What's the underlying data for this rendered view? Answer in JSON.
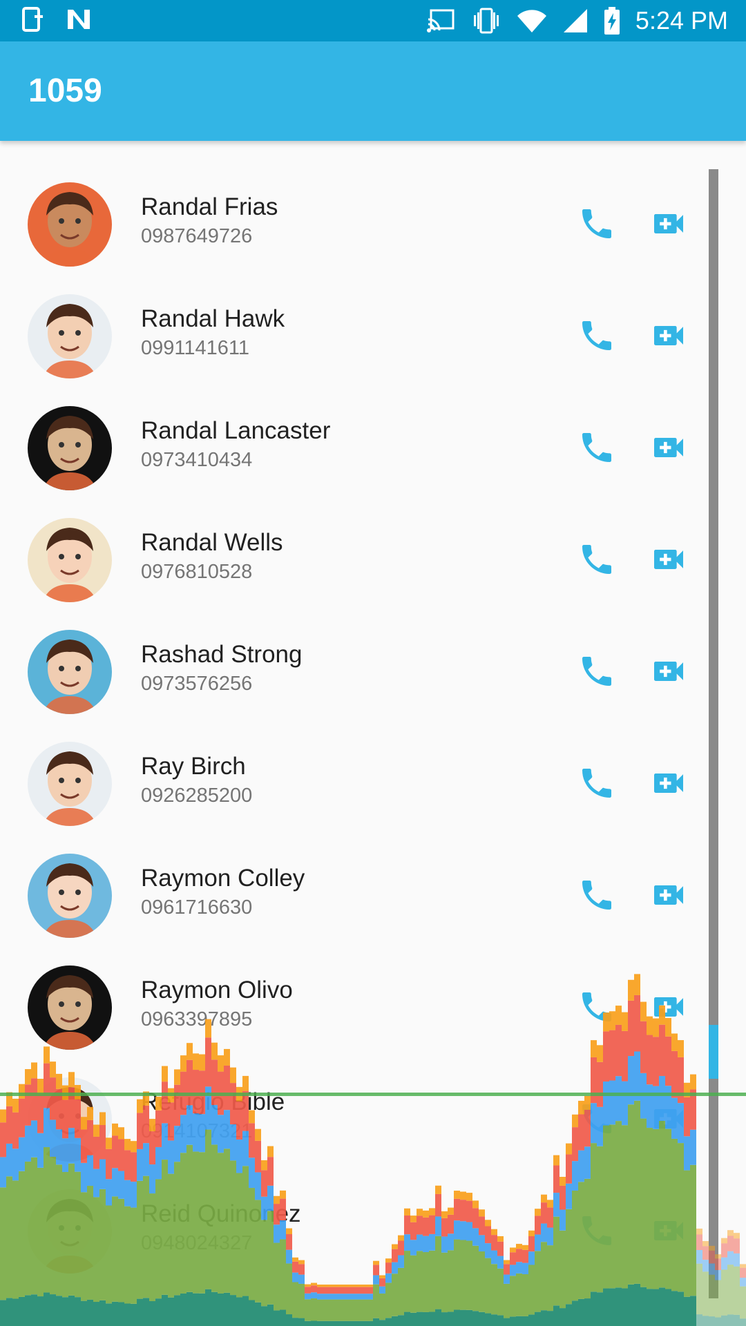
{
  "status_bar": {
    "time": "5:24 PM",
    "icons": [
      "sim-plus-icon",
      "n-notification-icon",
      "cast-icon",
      "vibrate-icon",
      "wifi-icon",
      "signal-icon",
      "battery-charging-icon"
    ]
  },
  "app_bar": {
    "title": "1059"
  },
  "colors": {
    "accent": "#33b5e5",
    "status_bar": "#0396c8",
    "background": "#fafafa"
  },
  "contacts": [
    {
      "name": "Randal Frias",
      "phone": "0987649726",
      "avatar_color": "#e8683a",
      "skin": "#c98a5e"
    },
    {
      "name": "Randal Hawk",
      "phone": "0991141611",
      "avatar_color": "#e9eef2",
      "skin": "#f3cfb3"
    },
    {
      "name": "Randal Lancaster",
      "phone": "0973410434",
      "avatar_color": "#111111",
      "skin": "#d9b58f"
    },
    {
      "name": "Randal Wells",
      "phone": "0976810528",
      "avatar_color": "#f1e4c8",
      "skin": "#f6d2b9"
    },
    {
      "name": "Rashad Strong",
      "phone": "0973576256",
      "avatar_color": "#5bb3d8",
      "skin": "#f0cdb2"
    },
    {
      "name": "Ray Birch",
      "phone": "0926285200",
      "avatar_color": "#e9eef2",
      "skin": "#f3cfb3"
    },
    {
      "name": "Raymon Colley",
      "phone": "0961716630",
      "avatar_color": "#6fb9df",
      "skin": "#f6d6c0"
    },
    {
      "name": "Raymon Olivo",
      "phone": "0963397895",
      "avatar_color": "#111111",
      "skin": "#d9b58f"
    },
    {
      "name": "Refugio Bible",
      "phone": "0914107321",
      "avatar_color": "#e9eef2",
      "skin": "#f3cfb3"
    },
    {
      "name": "Reid Quinonez",
      "phone": "0948024327",
      "avatar_color": "#f1e4c8",
      "skin": "#f6d2b9"
    }
  ],
  "gpu_overlay": {
    "colors": [
      "#1e8a70",
      "#79ab44",
      "#3fa0f0",
      "#f05a4a",
      "#f9a01b"
    ]
  }
}
